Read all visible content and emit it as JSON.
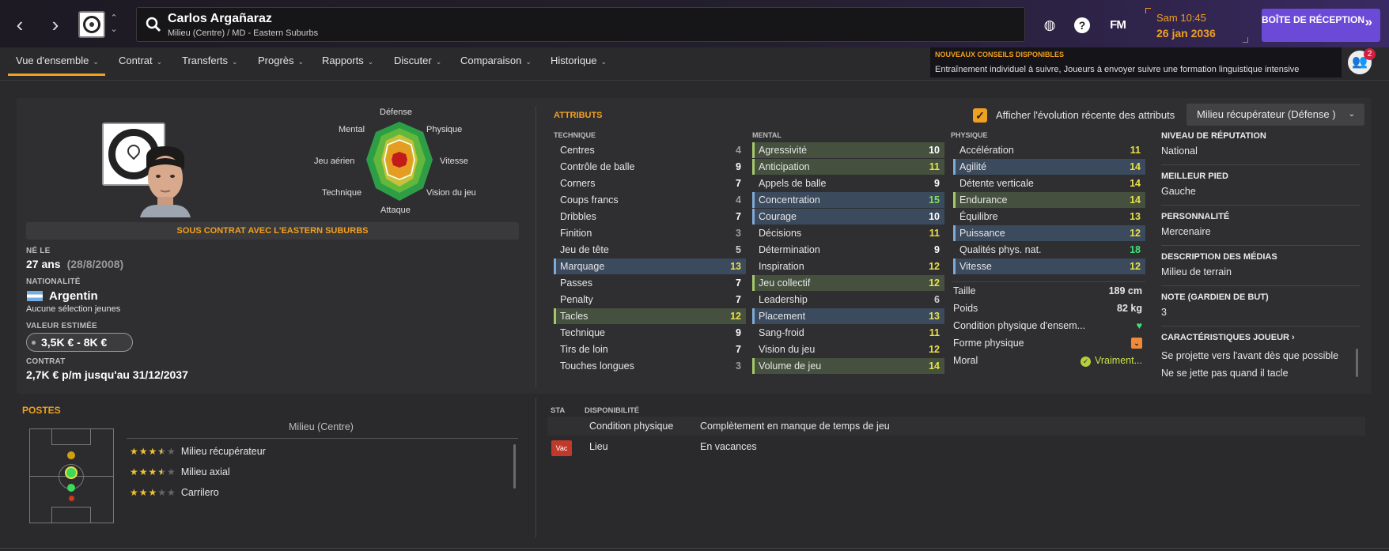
{
  "header": {
    "player_name": "Carlos Argañaraz",
    "player_sub": "Milieu (Centre) / MD - Eastern Suburbs",
    "time": "Sam 10:45",
    "date": "26 jan 2036",
    "inbox_label": "BOÎTE DE RÉCEPTION",
    "fm_label": "FM",
    "help_label": "?"
  },
  "tabs": [
    {
      "label": "Vue d'ensemble"
    },
    {
      "label": "Contrat"
    },
    {
      "label": "Transferts"
    },
    {
      "label": "Progrès"
    },
    {
      "label": "Rapports"
    },
    {
      "label": "Discuter"
    },
    {
      "label": "Comparaison"
    },
    {
      "label": "Historique"
    }
  ],
  "advice": {
    "title": "NOUVEAUX CONSEILS DISPONIBLES",
    "text": "Entraînement individuel à suivre, Joueurs à envoyer suivre une formation linguistique intensive",
    "count": "2"
  },
  "profile": {
    "contract_banner": "SOUS CONTRAT AVEC L'EASTERN SUBURBS",
    "born_label": "NÉ LE",
    "age": "27 ans",
    "birthdate": "(28/8/2008)",
    "nationality_label": "NATIONALITÉ",
    "nationality": "Argentin",
    "caps": "Aucune sélection jeunes",
    "value_label": "VALEUR ESTIMÉE",
    "value": "3,5K € - 8K €",
    "contract_label": "CONTRAT",
    "contract": "2,7K € p/m jusqu'au 31/12/2037"
  },
  "radar": {
    "labels": {
      "defense": "Défense",
      "physique": "Physique",
      "vitesse": "Vitesse",
      "vision": "Vision du jeu",
      "attaque": "Attaque",
      "technique": "Technique",
      "aerien": "Jeu aérien",
      "mental": "Mental"
    }
  },
  "attributes": {
    "title": "ATTRIBUTS",
    "toggle_label": "Afficher l'évolution récente des attributs",
    "role": "Milieu récupérateur (Défense )",
    "technique_header": "TECHNIQUE",
    "mental_header": "MENTAL",
    "physique_header": "PHYSIQUE",
    "technique": [
      {
        "name": "Centres",
        "value": "4",
        "c": "c4",
        "h": ""
      },
      {
        "name": "Contrôle de balle",
        "value": "9",
        "c": "cw",
        "h": ""
      },
      {
        "name": "Corners",
        "value": "7",
        "c": "cw",
        "h": ""
      },
      {
        "name": "Coups francs",
        "value": "4",
        "c": "c4",
        "h": ""
      },
      {
        "name": "Dribbles",
        "value": "7",
        "c": "cw",
        "h": ""
      },
      {
        "name": "Finition",
        "value": "3",
        "c": "c3",
        "h": ""
      },
      {
        "name": "Jeu de tête",
        "value": "5",
        "c": "c5",
        "h": ""
      },
      {
        "name": "Marquage",
        "value": "13",
        "c": "cy",
        "h": "hb"
      },
      {
        "name": "Passes",
        "value": "7",
        "c": "cw",
        "h": ""
      },
      {
        "name": "Penalty",
        "value": "7",
        "c": "cw",
        "h": ""
      },
      {
        "name": "Tacles",
        "value": "12",
        "c": "cy",
        "h": "hg"
      },
      {
        "name": "Technique",
        "value": "9",
        "c": "cw",
        "h": ""
      },
      {
        "name": "Tirs de loin",
        "value": "7",
        "c": "cw",
        "h": ""
      },
      {
        "name": "Touches longues",
        "value": "3",
        "c": "c3",
        "h": ""
      }
    ],
    "mental": [
      {
        "name": "Agressivité",
        "value": "10",
        "c": "cw",
        "h": "hg"
      },
      {
        "name": "Anticipation",
        "value": "11",
        "c": "cy",
        "h": "hg"
      },
      {
        "name": "Appels de balle",
        "value": "9",
        "c": "cw",
        "h": ""
      },
      {
        "name": "Concentration",
        "value": "15",
        "c": "cg",
        "h": "hb"
      },
      {
        "name": "Courage",
        "value": "10",
        "c": "cw",
        "h": "hb"
      },
      {
        "name": "Décisions",
        "value": "11",
        "c": "cy",
        "h": ""
      },
      {
        "name": "Détermination",
        "value": "9",
        "c": "cw",
        "h": ""
      },
      {
        "name": "Inspiration",
        "value": "12",
        "c": "cy",
        "h": ""
      },
      {
        "name": "Jeu collectif",
        "value": "12",
        "c": "cy",
        "h": "hg"
      },
      {
        "name": "Leadership",
        "value": "6",
        "c": "c5",
        "h": ""
      },
      {
        "name": "Placement",
        "value": "13",
        "c": "cy",
        "h": "hb"
      },
      {
        "name": "Sang-froid",
        "value": "11",
        "c": "cy",
        "h": ""
      },
      {
        "name": "Vision du jeu",
        "value": "12",
        "c": "cy",
        "h": ""
      },
      {
        "name": "Volume de jeu",
        "value": "14",
        "c": "cy",
        "h": "hg"
      }
    ],
    "physique": [
      {
        "name": "Accélération",
        "value": "11",
        "c": "cy",
        "h": ""
      },
      {
        "name": "Agilité",
        "value": "14",
        "c": "cy",
        "h": "hb"
      },
      {
        "name": "Détente verticale",
        "value": "14",
        "c": "cy",
        "h": ""
      },
      {
        "name": "Endurance",
        "value": "14",
        "c": "cy",
        "h": "hg"
      },
      {
        "name": "Équilibre",
        "value": "13",
        "c": "cy",
        "h": ""
      },
      {
        "name": "Puissance",
        "value": "12",
        "c": "cy",
        "h": "hb"
      },
      {
        "name": "Qualités phys. nat.",
        "value": "18",
        "c": "cgg",
        "h": ""
      },
      {
        "name": "Vitesse",
        "value": "12",
        "c": "cy",
        "h": "hb"
      }
    ],
    "taille_label": "Taille",
    "taille": "189 cm",
    "poids_label": "Poids",
    "poids": "82 kg",
    "condition_label": "Condition physique d'ensem...",
    "forme_label": "Forme physique",
    "moral_label": "Moral",
    "moral_value": "Vraiment..."
  },
  "info": {
    "rep_label": "NIVEAU DE RÉPUTATION",
    "rep": "National",
    "foot_label": "MEILLEUR PIED",
    "foot": "Gauche",
    "pers_label": "PERSONNALITÉ",
    "pers": "Mercenaire",
    "media_label": "DESCRIPTION DES MÉDIAS",
    "media": "Milieu de terrain",
    "gk_label": "NOTE (GARDIEN DE BUT)",
    "gk": "3",
    "traits_label": "CARACTÉRISTIQUES JOUEUR ›",
    "trait1": "Se projette vers l'avant dès que possible",
    "trait2": "Ne se jette pas quand il tacle"
  },
  "postes": {
    "title": "POSTES",
    "position": "Milieu (Centre)",
    "roles": [
      {
        "name": "Milieu récupérateur",
        "stars": 3.5
      },
      {
        "name": "Milieu axial",
        "stars": 3.5
      },
      {
        "name": "Carrilero",
        "stars": 3
      }
    ]
  },
  "availability": {
    "sta_label": "STA",
    "dispo_label": "DISPONIBILITÉ",
    "rows": [
      {
        "badge": "",
        "label": "Condition physique",
        "value": "Complètement en manque de temps de jeu"
      },
      {
        "badge": "Vac",
        "label": "Lieu",
        "value": "En vacances"
      }
    ]
  },
  "colors": {
    "accent": "#f0a020",
    "inbox": "#6c4ad8",
    "good": "#41e07a"
  }
}
